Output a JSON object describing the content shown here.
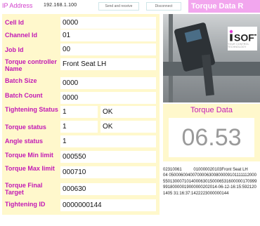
{
  "header": {
    "ip_label": "IP Address",
    "ip_value": "192.168.1.100",
    "send_button": "Send and receive",
    "disconnect_button": "Disconnect",
    "banner_title": "Torque Data R"
  },
  "form": {
    "cell_id": {
      "label": "Cell Id",
      "value": "0000"
    },
    "channel_id": {
      "label": "Channel Id",
      "value": "01"
    },
    "job_id": {
      "label": "Job Id",
      "value": "00"
    },
    "torque_controller_name": {
      "label": "Torque controller Name",
      "value": "Front Seat LH"
    },
    "batch_size": {
      "label": "Batch Size",
      "value": "0000"
    },
    "batch_count": {
      "label": "Batch Count",
      "value": "0000"
    },
    "tightening_status": {
      "label": "Tightening Status",
      "value": "1",
      "status": "OK"
    },
    "torque_status": {
      "label": "Torque status",
      "value": "1",
      "status": "OK"
    },
    "angle_status": {
      "label": "Angle status",
      "value": "1"
    },
    "torque_min_limit": {
      "label": "Torque Min limit",
      "value": "000550"
    },
    "torque_max_limit": {
      "label": "Torque Max limit",
      "value": "000710"
    },
    "torque_final_target": {
      "label": "Torque Final Target",
      "value": "000630"
    },
    "tightening_id": {
      "label": "Tightening ID",
      "value": "0000000144"
    }
  },
  "torque_data": {
    "title": "Torque Data",
    "value": "06.53"
  },
  "logo": {
    "text": "iSOFT",
    "tagline": "YOUR CONTROL TECHNOLOGY"
  },
  "raw_message": "02310061          010000020103Front Seat LH          04 05000600400700006300800009101111112000550130007101400063015000653160000017099999180000019000000202014-06-12-16:15:5921201405 31:16:37:1422223000000144",
  "colors": {
    "label": "#c21ab5",
    "panel": "#fff8cc",
    "banner": "#f2a6ee",
    "value_text": "#9a9a9a"
  }
}
